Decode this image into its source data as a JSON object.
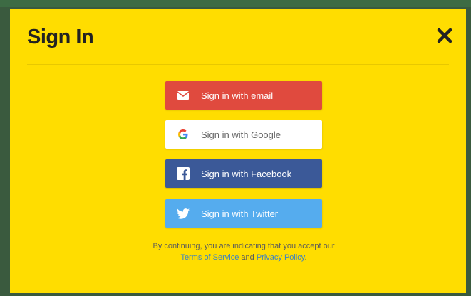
{
  "dialog": {
    "title": "Sign In",
    "close_icon": "close-icon"
  },
  "buttons": [
    {
      "label": "Sign in with email",
      "icon": "mail-icon",
      "color": "#e04a3e"
    },
    {
      "label": "Sign in with Google",
      "icon": "google-icon",
      "color": "#ffffff"
    },
    {
      "label": "Sign in with Facebook",
      "icon": "facebook-icon",
      "color": "#3b5998"
    },
    {
      "label": "Sign in with Twitter",
      "icon": "twitter-icon",
      "color": "#55acee"
    }
  ],
  "legal": {
    "prefix": "By continuing, you are indicating that you accept our",
    "terms": "Terms of Service",
    "and": "and",
    "privacy": "Privacy Policy",
    "suffix": "."
  },
  "colors": {
    "background": "#ffdd00",
    "link": "#3b82c4"
  }
}
